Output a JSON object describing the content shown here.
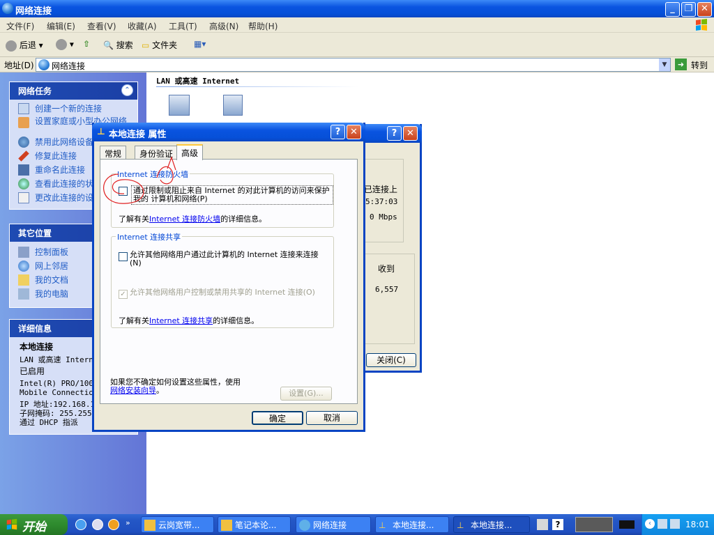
{
  "window": {
    "title": "网络连接"
  },
  "menu": [
    "文件(F)",
    "编辑(E)",
    "查看(V)",
    "收藏(A)",
    "工具(T)",
    "高级(N)",
    "帮助(H)"
  ],
  "toolbar": {
    "back": "后退",
    "search": "搜索",
    "folders": "文件夹"
  },
  "address": {
    "label": "地址(D)",
    "value": "网络连接",
    "go": "转到"
  },
  "content": {
    "section_title": "LAN 或高速 Internet"
  },
  "tasks": {
    "title": "网络任务",
    "items": [
      "创建一个新的连接",
      "设置家庭或小型办公网络",
      "禁用此网络设备",
      "修复此连接",
      "重命名此连接",
      "查看此连接的状态",
      "更改此连接的设置"
    ]
  },
  "places": {
    "title": "其它位置",
    "items": [
      "控制面板",
      "网上邻居",
      "我的文档",
      "我的电脑"
    ]
  },
  "details": {
    "title": "详细信息",
    "name": "本地连接",
    "lines": [
      "LAN 或高速 Internet",
      "已启用",
      "Intel(R) PRO/1000",
      "Mobile Connection",
      "IP 地址:192.168.1",
      "子网掩码: 255.255.",
      "通过 DHCP 指派"
    ]
  },
  "status_dialog": {
    "connected": "已连接上",
    "duration": "5:37:03",
    "speed": "0 Mbps",
    "received_label": "收到",
    "received": "6,557",
    "close_btn": "关闭(C)"
  },
  "dialog": {
    "title": "本地连接 属性",
    "tabs": [
      "常规",
      "身份验证",
      "高级"
    ],
    "firewall": {
      "group": "Internet 连接防火墙",
      "checkbox": "通过限制或阻止来自 Internet 的对此计算机的访问来保护我的 计算机和网络(P)",
      "info_prefix": "了解有关",
      "info_link": "Internet 连接防火墙",
      "info_suffix": "的详细信息。"
    },
    "ics": {
      "group": "Internet 连接共享",
      "checkbox1": "允许其他网络用户通过此计算机的 Internet 连接来连接(N)",
      "checkbox2": "允许其他网络用户控制或禁用共享的 Internet 连接(O)",
      "info_prefix": "了解有关",
      "info_link": "Internet 连接共享",
      "info_suffix": "的详细信息。"
    },
    "footer": {
      "text": "如果您不确定如何设置这些属性，使用",
      "link": "网络安装向导",
      "end": "。",
      "settings": "设置(G)..."
    },
    "ok": "确定",
    "cancel": "取消"
  },
  "taskbar": {
    "start": "开始",
    "items": [
      "云岗宽带...",
      "笔记本论...",
      "网络连接",
      "本地连接...",
      "本地连接..."
    ],
    "clock": "18:01"
  }
}
